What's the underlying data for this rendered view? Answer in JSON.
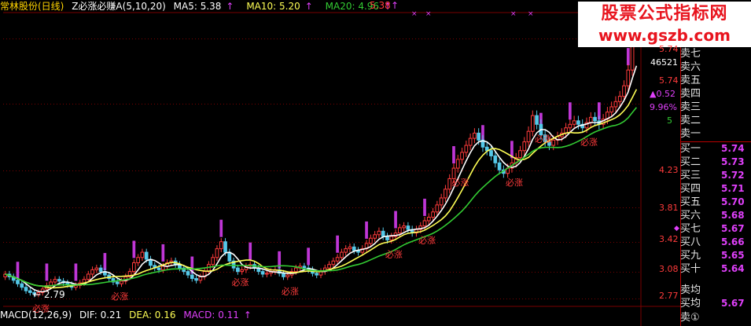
{
  "header": {
    "stock": "常林股份(日线)",
    "indicator": "Z必涨必赚A(5,10,20)",
    "ma5": "MA5: 5.38",
    "ma10": "MA10: 5.20",
    "ma20": "MA20: 4.96",
    "price_marker": "5.38"
  },
  "macd": {
    "name": "MACD(12,26,9)",
    "dif": "DIF: 0.21",
    "dea": "DEA: 0.16",
    "macd": "MACD: 0.11"
  },
  "watermark": {
    "line1": "股票公式指标网",
    "line2": "www.gszb.com"
  },
  "price_axis": [
    "5.74",
    "5.74",
    "5",
    "4.23",
    "3.81",
    "3.42",
    "3.08",
    "2.77"
  ],
  "side_stats": {
    "volume": "46521",
    "change": "▲0.52",
    "pct": "9.96%"
  },
  "low_marker": "2.79",
  "signal_label": "必涨",
  "orderbook": {
    "asks": [
      "卖七",
      "卖六",
      "卖五",
      "卖四",
      "卖三",
      "卖二",
      "卖一"
    ],
    "bids": [
      {
        "label": "买一",
        "price": "5.74"
      },
      {
        "label": "买二",
        "price": "5.73"
      },
      {
        "label": "买三",
        "price": "5.72"
      },
      {
        "label": "买四",
        "price": "5.71"
      },
      {
        "label": "买五",
        "price": "5.70"
      },
      {
        "label": "买六",
        "price": "5.68"
      },
      {
        "label": "买七",
        "price": "5.67"
      },
      {
        "label": "买八",
        "price": "5.66"
      },
      {
        "label": "买九",
        "price": "5.65"
      },
      {
        "label": "买十",
        "price": "5.64"
      }
    ],
    "avg_sell": "卖均",
    "avg_buy": "买均",
    "avg_buy_price": "5.67",
    "sell_one_circled": "卖①"
  },
  "colors": {
    "up": "#ff3b3b",
    "down": "#54c8e8",
    "ma5": "#ffffff",
    "ma10": "#ffff55",
    "ma20": "#33cc33",
    "signal": "#e040fb",
    "grid": "#7a0000"
  },
  "chart_data": {
    "type": "candlestick",
    "ylim": [
      2.7,
      6.0
    ],
    "ticks": [
      2.77,
      3.08,
      3.42,
      3.81,
      4.23,
      5.0,
      5.74
    ],
    "closes": [
      3.05,
      3.02,
      2.98,
      2.94,
      2.9,
      2.86,
      2.84,
      2.82,
      2.84,
      2.88,
      2.92,
      2.96,
      2.99,
      2.97,
      2.95,
      2.93,
      2.9,
      2.92,
      2.95,
      2.99,
      3.05,
      3.1,
      3.12,
      3.08,
      3.04,
      3.0,
      2.96,
      2.94,
      2.97,
      3.02,
      3.08,
      3.18,
      3.24,
      3.3,
      3.22,
      3.15,
      3.12,
      3.1,
      3.14,
      3.18,
      3.2,
      3.16,
      3.12,
      3.08,
      3.04,
      3.0,
      2.98,
      3.02,
      3.08,
      3.16,
      3.24,
      3.34,
      3.42,
      3.3,
      3.2,
      3.12,
      3.08,
      3.1,
      3.14,
      3.16,
      3.12,
      3.08,
      3.05,
      3.06,
      3.08,
      3.1,
      3.06,
      3.02,
      3.04,
      3.08,
      3.12,
      3.14,
      3.12,
      3.1,
      3.06,
      3.04,
      3.08,
      3.12,
      3.16,
      3.2,
      3.24,
      3.3,
      3.34,
      3.36,
      3.32,
      3.3,
      3.34,
      3.4,
      3.46,
      3.5,
      3.54,
      3.48,
      3.44,
      3.48,
      3.52,
      3.58,
      3.6,
      3.56,
      3.52,
      3.56,
      3.6,
      3.66,
      3.7,
      3.76,
      3.84,
      3.92,
      4.02,
      4.14,
      4.26,
      4.36,
      4.44,
      4.52,
      4.6,
      4.66,
      4.58,
      4.5,
      4.46,
      4.4,
      4.32,
      4.24,
      4.2,
      4.26,
      4.32,
      4.38,
      4.46,
      4.56,
      4.68,
      4.86,
      4.76,
      4.64,
      4.56,
      4.52,
      4.58,
      4.62,
      4.66,
      4.72,
      4.76,
      4.8,
      4.76,
      4.72,
      4.78,
      4.84,
      4.8,
      4.76,
      4.82,
      4.9,
      4.96,
      5.02,
      5.08,
      5.2,
      5.38,
      5.74,
      5.74
    ]
  }
}
